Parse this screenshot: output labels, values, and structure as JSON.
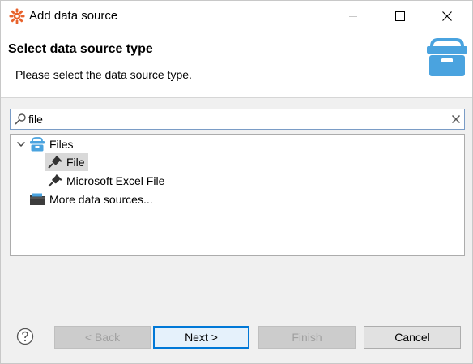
{
  "window": {
    "title": "Add data source"
  },
  "header": {
    "title": "Select data source type",
    "description": "Please select the data source type."
  },
  "search": {
    "value": "file",
    "placeholder": ""
  },
  "tree": {
    "items": [
      {
        "label": "Files",
        "expanded": true,
        "icon": "folder-open-icon"
      },
      {
        "label": "File",
        "selected": true,
        "icon": "plug-icon"
      },
      {
        "label": "Microsoft Excel File",
        "selected": false,
        "icon": "plug-icon"
      },
      {
        "label": "More data sources...",
        "icon": "folder-icon"
      }
    ]
  },
  "buttons": {
    "back": "< Back",
    "next": "Next >",
    "finish": "Finish",
    "cancel": "Cancel"
  },
  "colors": {
    "accent": "#0078d7",
    "header_icon": "#4aa3df",
    "app_icon": "#e8622c"
  }
}
